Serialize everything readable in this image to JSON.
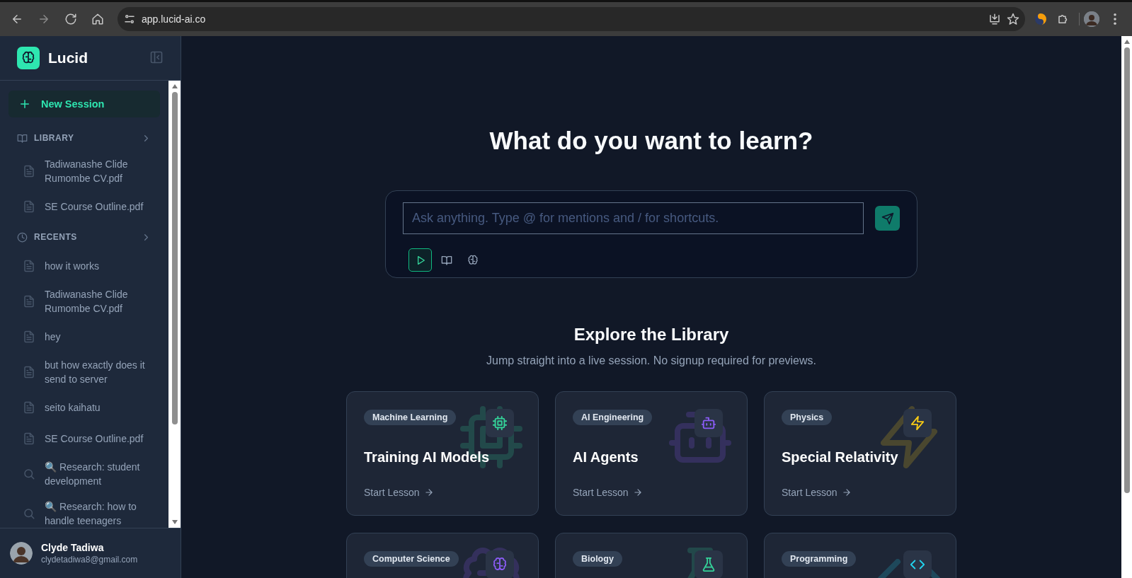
{
  "browser": {
    "url": "app.lucid-ai.co"
  },
  "sidebar": {
    "brand": "Lucid",
    "new_session": "New Session",
    "sections": [
      {
        "title": "LIBRARY",
        "kind": "book",
        "items": [
          {
            "label": "Tadiwanashe Clide Rumombe CV.pdf",
            "kind": "file"
          },
          {
            "label": "SE Course Outline.pdf",
            "kind": "file"
          }
        ]
      },
      {
        "title": "RECENTS",
        "kind": "clock",
        "items": [
          {
            "label": "how it works",
            "kind": "file"
          },
          {
            "label": "Tadiwanashe Clide Rumombe CV.pdf",
            "kind": "file"
          },
          {
            "label": "hey",
            "kind": "file"
          },
          {
            "label": "but how exactly does it send to server",
            "kind": "file"
          },
          {
            "label": "seito kaihatu",
            "kind": "file"
          },
          {
            "label": "SE Course Outline.pdf",
            "kind": "file"
          },
          {
            "label": "🔍 Research: student development",
            "kind": "search"
          },
          {
            "label": "🔍 Research: how to handle teenagers",
            "kind": "search"
          }
        ]
      }
    ],
    "user": {
      "name": "Clyde Tadiwa",
      "email": "clydetadiwa8@gmail.com"
    }
  },
  "main": {
    "heading": "What do you want to learn?",
    "prompt": {
      "placeholder": "Ask anything. Type @ for mentions and / for shortcuts."
    },
    "modes": [
      {
        "kind": "play",
        "selected": true
      },
      {
        "kind": "book",
        "selected": false
      },
      {
        "kind": "brain",
        "selected": false
      }
    ],
    "explore": {
      "title": "Explore the Library",
      "subtitle": "Jump straight into a live session. No signup required for previews."
    },
    "cards": [
      {
        "tag": "Machine Learning",
        "title": "Training AI Models",
        "cta": "Start Lesson",
        "kind": "chip",
        "color": "#34d399"
      },
      {
        "tag": "AI Engineering",
        "title": "AI Agents",
        "cta": "Start Lesson",
        "kind": "bot",
        "color": "#8b5cf6"
      },
      {
        "tag": "Physics",
        "title": "Special Relativity",
        "cta": "Start Lesson",
        "kind": "zap",
        "color": "#facc15"
      },
      {
        "tag": "Computer Science",
        "kind": "brain",
        "color": "#8b5cf6"
      },
      {
        "tag": "Biology",
        "kind": "flask",
        "color": "#34d399"
      },
      {
        "tag": "Programming",
        "kind": "code",
        "color": "#22d3ee"
      }
    ]
  }
}
